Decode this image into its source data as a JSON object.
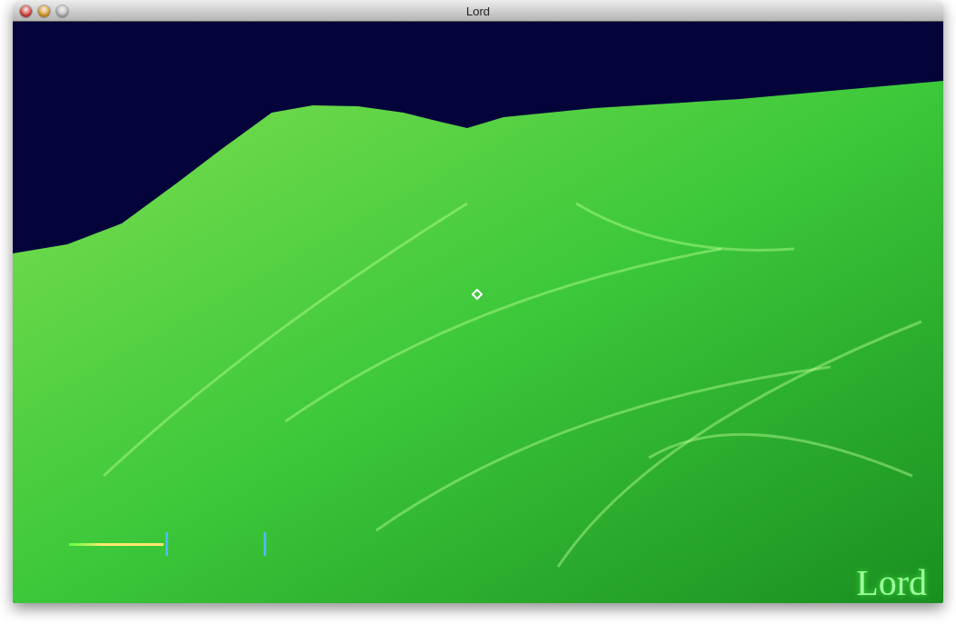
{
  "window": {
    "title": "Lord",
    "buttons": [
      {
        "kind": "close",
        "disabled": false
      },
      {
        "kind": "minimize",
        "disabled": false
      },
      {
        "kind": "zoom",
        "disabled": true
      }
    ]
  },
  "game_view": {
    "overlay_title": "Lord"
  }
}
